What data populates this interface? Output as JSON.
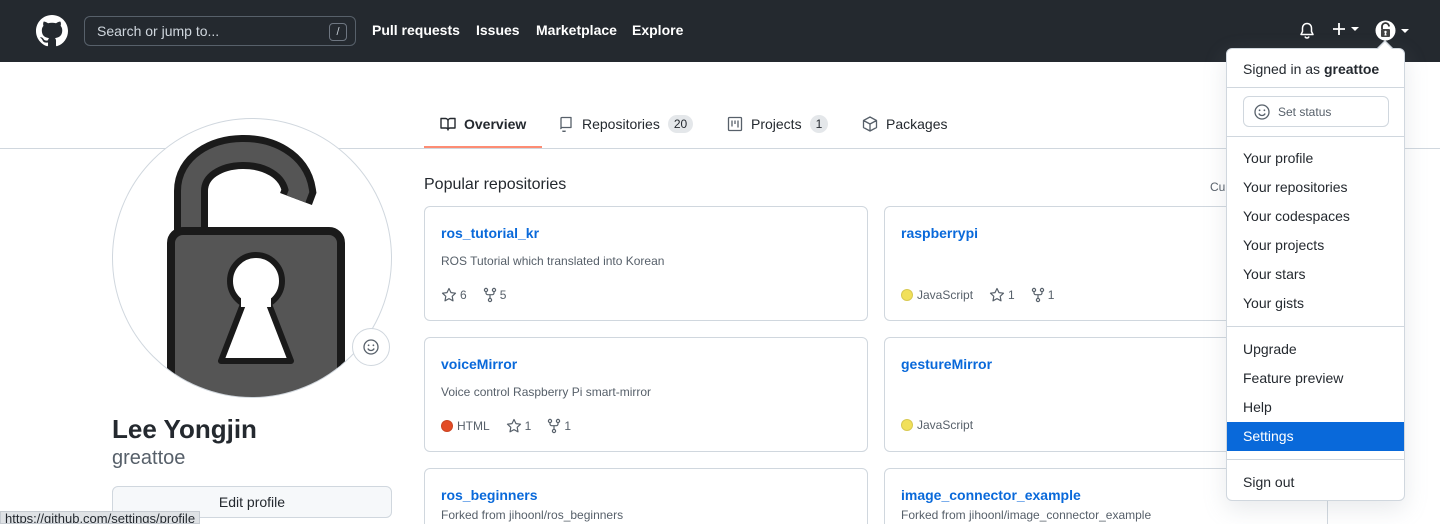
{
  "header": {
    "search_placeholder": "Search or jump to...",
    "search_shortcut": "/",
    "nav": [
      "Pull requests",
      "Issues",
      "Marketplace",
      "Explore"
    ]
  },
  "tabs": [
    {
      "label": "Overview",
      "count": null,
      "icon": "book-icon",
      "active": true
    },
    {
      "label": "Repositories",
      "count": "20",
      "icon": "repo-icon"
    },
    {
      "label": "Projects",
      "count": "1",
      "icon": "project-icon"
    },
    {
      "label": "Packages",
      "count": null,
      "icon": "package-icon"
    }
  ],
  "profile": {
    "full_name": "Lee Yongjin",
    "login": "greattoe",
    "edit_label": "Edit profile"
  },
  "status_bar_url": "https://github.com/settings/profile",
  "repos": {
    "title": "Popular repositories",
    "customize_label": "Cu",
    "items": [
      {
        "name": "ros_tutorial_kr",
        "desc": "ROS Tutorial which translated into Korean",
        "lang": "",
        "lang_color": "",
        "stars": "6",
        "forks": "5"
      },
      {
        "name": "raspberrypi",
        "desc": "",
        "lang": "JavaScript",
        "lang_color": "#f1e05a",
        "stars": "1",
        "forks": "1"
      },
      {
        "name": "voiceMirror",
        "desc": "Voice control Raspberry Pi smart-mirror",
        "lang": "HTML",
        "lang_color": "#e34c26",
        "stars": "1",
        "forks": "1"
      },
      {
        "name": "gestureMirror",
        "desc": "",
        "lang": "JavaScript",
        "lang_color": "#f1e05a",
        "stars": "",
        "forks": ""
      },
      {
        "name": "ros_beginners",
        "desc": "Forked from jihoonl/ros_beginners",
        "lang": "",
        "lang_color": "",
        "stars": "",
        "forks": ""
      },
      {
        "name": "image_connector_example",
        "desc": "Forked from jihoonl/image_connector_example",
        "lang": "",
        "lang_color": "",
        "stars": "",
        "forks": ""
      }
    ]
  },
  "dropdown": {
    "signed_in_prefix": "Signed in as",
    "username": "greattoe",
    "set_status": "Set status",
    "group1": [
      "Your profile",
      "Your repositories",
      "Your codespaces",
      "Your projects",
      "Your stars",
      "Your gists"
    ],
    "group2": [
      "Upgrade",
      "Feature preview",
      "Help",
      "Settings"
    ],
    "sign_out": "Sign out",
    "selected": "Settings"
  },
  "colors": {
    "header_bg": "#24292f",
    "link": "#0969da",
    "tab_underline": "#fd8c73",
    "selected_bg": "#0969da"
  }
}
